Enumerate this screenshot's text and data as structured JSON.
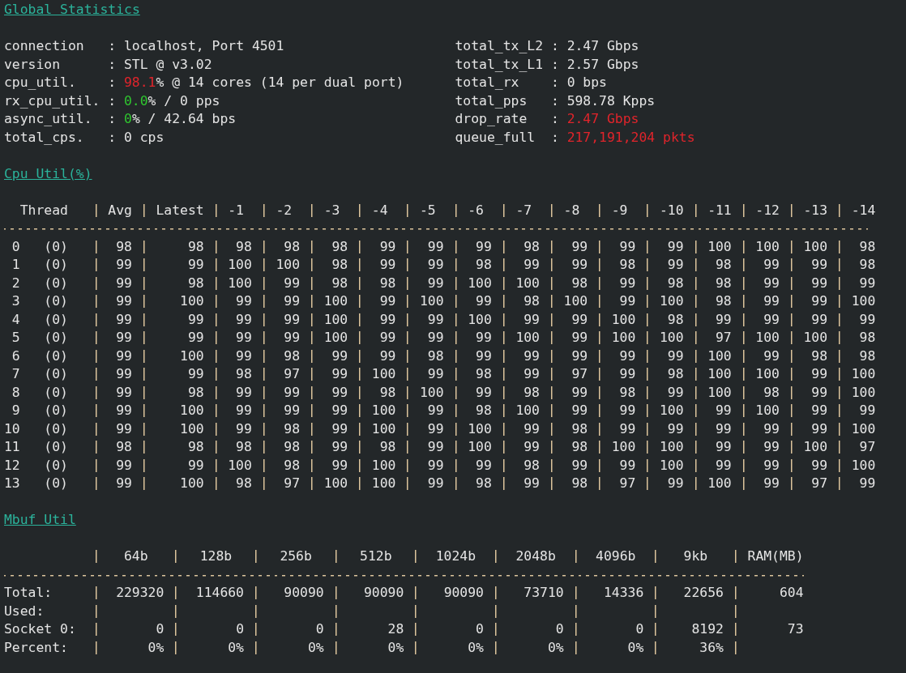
{
  "global_statistics": {
    "title": "Global Statistics",
    "left": [
      {
        "label": "connection",
        "sep": ":",
        "value": [
          {
            "text": "localhost, Port 4501",
            "kind": "normal"
          }
        ]
      },
      {
        "label": "version",
        "sep": ":",
        "value": [
          {
            "text": "STL @ v3.02",
            "kind": "normal"
          }
        ]
      },
      {
        "label": "cpu_util.",
        "sep": ":",
        "value": [
          {
            "text": "98.1",
            "kind": "alert"
          },
          {
            "text": "% @ 14 cores (14 per dual port)",
            "kind": "normal"
          }
        ]
      },
      {
        "label": "rx_cpu_util.",
        "sep": ":",
        "value": [
          {
            "text": "0.0",
            "kind": "ok"
          },
          {
            "text": "% / 0 pps",
            "kind": "normal"
          }
        ]
      },
      {
        "label": "async_util.",
        "sep": ":",
        "value": [
          {
            "text": "0",
            "kind": "ok"
          },
          {
            "text": "% / 42.64 bps",
            "kind": "normal"
          }
        ]
      },
      {
        "label": "total_cps.",
        "sep": ":",
        "value": [
          {
            "text": "0 cps",
            "kind": "normal"
          }
        ]
      }
    ],
    "right": [
      {
        "label": "total_tx_L2",
        "sep": ":",
        "value": [
          {
            "text": "2.47 Gbps",
            "kind": "normal"
          }
        ]
      },
      {
        "label": "total_tx_L1",
        "sep": ":",
        "value": [
          {
            "text": "2.57 Gbps",
            "kind": "normal"
          }
        ]
      },
      {
        "label": "total_rx",
        "sep": ":",
        "value": [
          {
            "text": "0 bps",
            "kind": "normal"
          }
        ]
      },
      {
        "label": "total_pps",
        "sep": ":",
        "value": [
          {
            "text": "598.78 Kpps",
            "kind": "normal"
          }
        ]
      },
      {
        "label": "drop_rate",
        "sep": ":",
        "value": [
          {
            "text": "2.47 Gbps",
            "kind": "alert"
          }
        ]
      },
      {
        "label": "queue_full",
        "sep": ":",
        "value": [
          {
            "text": "217,191,204 pkts",
            "kind": "alert"
          }
        ]
      }
    ]
  },
  "cpu_util": {
    "title": "Cpu Util(%)",
    "thread_header": "Thread",
    "columns": [
      "Avg",
      "Latest",
      "-1",
      "-2",
      "-3",
      "-4",
      "-5",
      "-6",
      "-7",
      "-8",
      "-9",
      "-10",
      "-11",
      "-12",
      "-13",
      "-14"
    ],
    "rows": [
      {
        "thread": "0",
        "socket": "(0)",
        "values": [
          "98",
          "98",
          "98",
          "98",
          "98",
          "99",
          "99",
          "99",
          "98",
          "99",
          "99",
          "99",
          "100",
          "100",
          "100",
          "98"
        ]
      },
      {
        "thread": "1",
        "socket": "(0)",
        "values": [
          "99",
          "99",
          "100",
          "100",
          "98",
          "99",
          "99",
          "98",
          "99",
          "99",
          "98",
          "99",
          "98",
          "99",
          "99",
          "98"
        ]
      },
      {
        "thread": "2",
        "socket": "(0)",
        "values": [
          "99",
          "98",
          "100",
          "99",
          "98",
          "98",
          "99",
          "100",
          "100",
          "98",
          "99",
          "98",
          "98",
          "99",
          "99",
          "99"
        ]
      },
      {
        "thread": "3",
        "socket": "(0)",
        "values": [
          "99",
          "100",
          "99",
          "99",
          "100",
          "99",
          "100",
          "99",
          "98",
          "100",
          "99",
          "100",
          "98",
          "99",
          "99",
          "100"
        ]
      },
      {
        "thread": "4",
        "socket": "(0)",
        "values": [
          "99",
          "99",
          "99",
          "99",
          "100",
          "99",
          "99",
          "100",
          "99",
          "99",
          "100",
          "98",
          "99",
          "99",
          "99",
          "99"
        ]
      },
      {
        "thread": "5",
        "socket": "(0)",
        "values": [
          "99",
          "99",
          "99",
          "99",
          "100",
          "99",
          "99",
          "99",
          "100",
          "99",
          "100",
          "100",
          "97",
          "100",
          "100",
          "98"
        ]
      },
      {
        "thread": "6",
        "socket": "(0)",
        "values": [
          "99",
          "100",
          "99",
          "98",
          "99",
          "99",
          "98",
          "99",
          "99",
          "99",
          "99",
          "99",
          "100",
          "99",
          "98",
          "98"
        ]
      },
      {
        "thread": "7",
        "socket": "(0)",
        "values": [
          "99",
          "99",
          "98",
          "97",
          "99",
          "100",
          "99",
          "98",
          "99",
          "97",
          "99",
          "98",
          "100",
          "100",
          "99",
          "100"
        ]
      },
      {
        "thread": "8",
        "socket": "(0)",
        "values": [
          "99",
          "98",
          "99",
          "99",
          "99",
          "98",
          "100",
          "99",
          "98",
          "99",
          "98",
          "99",
          "100",
          "98",
          "99",
          "100"
        ]
      },
      {
        "thread": "9",
        "socket": "(0)",
        "values": [
          "99",
          "100",
          "99",
          "99",
          "99",
          "100",
          "99",
          "98",
          "100",
          "99",
          "99",
          "100",
          "99",
          "100",
          "99",
          "99"
        ]
      },
      {
        "thread": "10",
        "socket": "(0)",
        "values": [
          "99",
          "100",
          "99",
          "98",
          "99",
          "100",
          "99",
          "100",
          "99",
          "98",
          "99",
          "99",
          "99",
          "99",
          "99",
          "100"
        ]
      },
      {
        "thread": "11",
        "socket": "(0)",
        "values": [
          "98",
          "98",
          "98",
          "98",
          "99",
          "98",
          "99",
          "100",
          "99",
          "98",
          "100",
          "100",
          "99",
          "99",
          "100",
          "97"
        ]
      },
      {
        "thread": "12",
        "socket": "(0)",
        "values": [
          "99",
          "99",
          "100",
          "98",
          "99",
          "100",
          "99",
          "99",
          "98",
          "99",
          "99",
          "100",
          "99",
          "99",
          "99",
          "100"
        ]
      },
      {
        "thread": "13",
        "socket": "(0)",
        "values": [
          "99",
          "100",
          "98",
          "97",
          "100",
          "100",
          "99",
          "98",
          "99",
          "98",
          "97",
          "99",
          "100",
          "99",
          "97",
          "99"
        ]
      }
    ]
  },
  "mbuf_util": {
    "title": "Mbuf Util",
    "columns": [
      "64b",
      "128b",
      "256b",
      "512b",
      "1024b",
      "2048b",
      "4096b",
      "9kb",
      "RAM(MB)"
    ],
    "rows": [
      {
        "label": "Total:",
        "values": [
          "229320",
          "114660",
          "90090",
          "90090",
          "90090",
          "73710",
          "14336",
          "22656",
          "604"
        ]
      },
      {
        "label": "Used:"
      },
      {
        "label": "Socket 0:",
        "values": [
          "0",
          "0",
          "0",
          "28",
          "0",
          "0",
          "0",
          "8192",
          "73"
        ]
      },
      {
        "label": "Percent:",
        "values": [
          "0%",
          "0%",
          "0%",
          "0%",
          "0%",
          "0%",
          "0%",
          "36%"
        ]
      }
    ]
  }
}
